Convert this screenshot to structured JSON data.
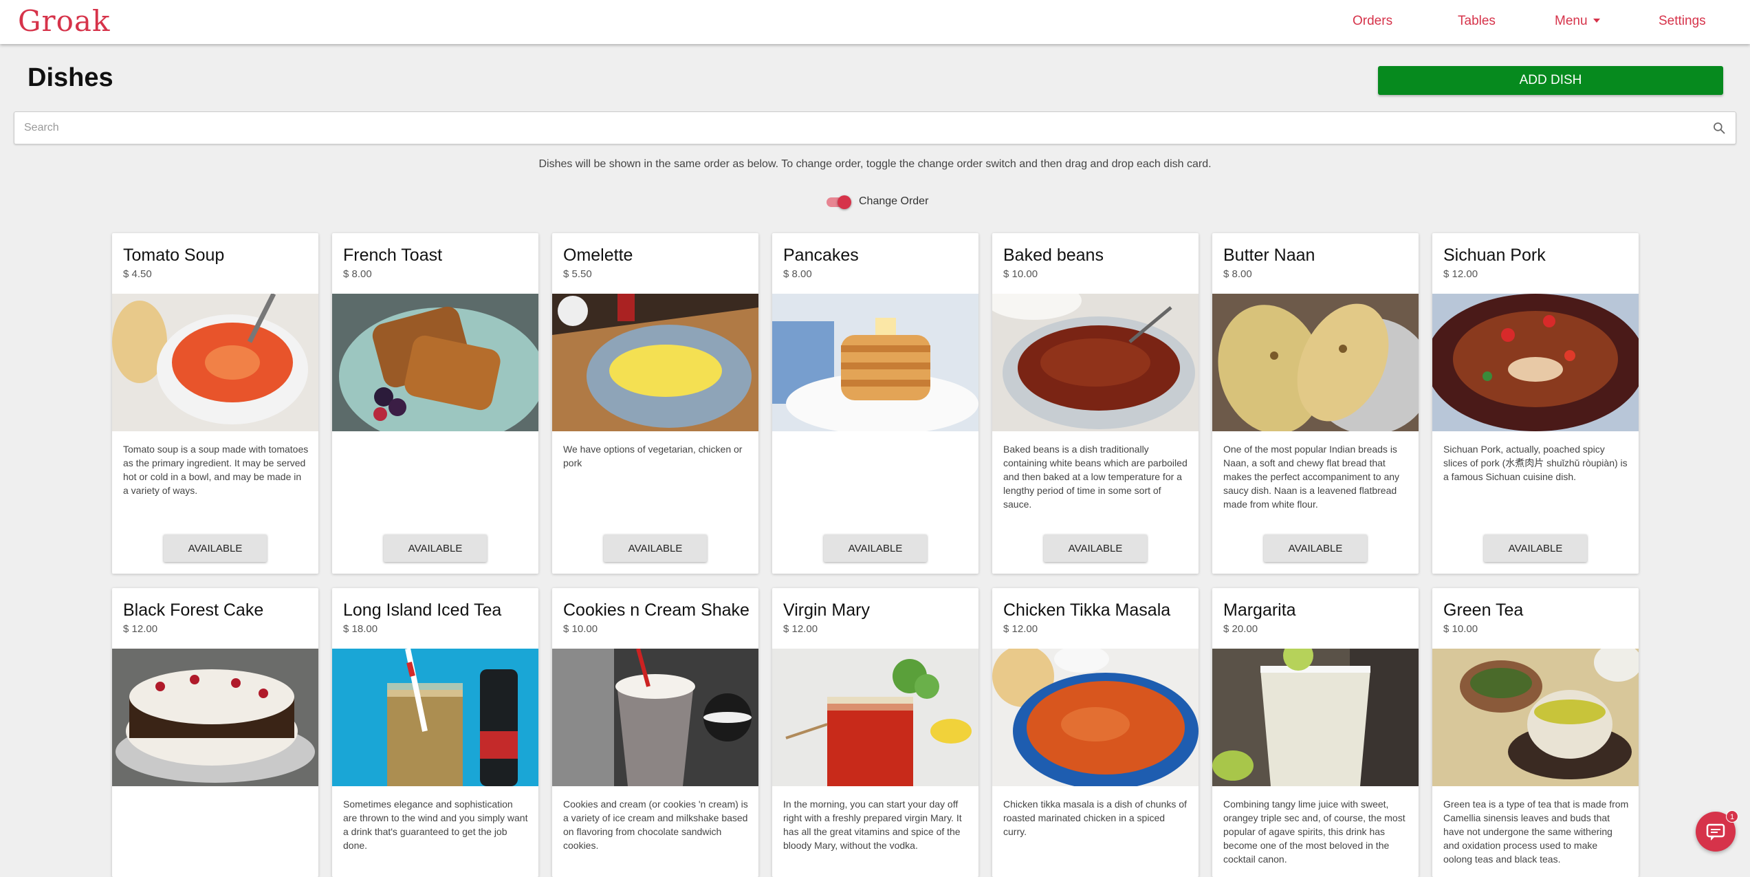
{
  "app": {
    "logo": "Groak"
  },
  "nav": {
    "orders": "Orders",
    "tables": "Tables",
    "menu": "Menu",
    "settings": "Settings"
  },
  "header": {
    "title": "Dishes",
    "add_button": "ADD DISH"
  },
  "search": {
    "placeholder": "Search",
    "value": ""
  },
  "helper_text": "Dishes will be shown in the same order as below. To change order, toggle the change order switch and then drag and drop each dish card.",
  "change_order": {
    "label": "Change Order",
    "on": true
  },
  "accent_color": "#d6334a",
  "add_button_color": "#068a1e",
  "dishes": [
    {
      "name": "Tomato Soup",
      "price": "$ 4.50",
      "description": "Tomato soup is a soup made with tomatoes as the primary ingredient. It may be served hot or cold in a bowl, and may be made in a variety of ways.",
      "status": "AVAILABLE",
      "image": "tomato-soup-image"
    },
    {
      "name": "French Toast",
      "price": "$ 8.00",
      "description": "",
      "status": "AVAILABLE",
      "image": "french-toast-image"
    },
    {
      "name": "Omelette",
      "price": "$ 5.50",
      "description": "We have options of vegetarian, chicken or pork",
      "status": "AVAILABLE",
      "image": "omelette-image"
    },
    {
      "name": "Pancakes",
      "price": "$ 8.00",
      "description": "",
      "status": "AVAILABLE",
      "image": "pancakes-image"
    },
    {
      "name": "Baked beans",
      "price": "$ 10.00",
      "description": "Baked beans is a dish traditionally containing white beans which are parboiled and then baked at a low temperature for a lengthy period of time in some sort of sauce.",
      "status": "AVAILABLE",
      "image": "baked-beans-image"
    },
    {
      "name": "Butter Naan",
      "price": "$ 8.00",
      "description": "One of the most popular Indian breads is Naan, a soft and chewy flat bread that makes the perfect accompaniment to any saucy dish. Naan is a leavened flatbread made from white flour.",
      "status": "AVAILABLE",
      "image": "butter-naan-image"
    },
    {
      "name": "Sichuan Pork",
      "price": "$ 12.00",
      "description": "Sichuan Pork, actually, poached spicy slices of pork (水煮肉片 shuǐzhǔ ròupiàn) is a famous Sichuan cuisine dish.",
      "status": "AVAILABLE",
      "image": "sichuan-pork-image"
    },
    {
      "name": "Black Forest Cake",
      "price": "$ 12.00",
      "description": "",
      "status": "",
      "image": "black-forest-cake-image"
    },
    {
      "name": "Long Island Iced Tea",
      "price": "$ 18.00",
      "description": "Sometimes elegance and sophistication are thrown to the wind and you simply want a drink that's guaranteed to get the job done.",
      "status": "",
      "image": "long-island-iced-tea-image"
    },
    {
      "name": "Cookies n Cream Shake",
      "price": "$ 10.00",
      "description": "Cookies and cream (or cookies 'n cream) is a variety of ice cream and milkshake based on flavoring from chocolate sandwich cookies.",
      "status": "",
      "image": "cookies-cream-shake-image"
    },
    {
      "name": "Virgin Mary",
      "price": "$ 12.00",
      "description": "In the morning, you can start your day off right with a freshly prepared virgin Mary. It has all the great vitamins and spice of the bloody Mary, without the vodka.",
      "status": "",
      "image": "virgin-mary-image"
    },
    {
      "name": "Chicken Tikka Masala",
      "price": "$ 12.00",
      "description": "Chicken tikka masala is a dish of chunks of roasted marinated chicken in a spiced curry.",
      "status": "",
      "image": "chicken-tikka-masala-image"
    },
    {
      "name": "Margarita",
      "price": "$ 20.00",
      "description": "Combining tangy lime juice with sweet, orangey triple sec and, of course, the most popular of agave spirits, this drink has become one of the most beloved in the cocktail canon.",
      "status": "",
      "image": "margarita-image"
    },
    {
      "name": "Green Tea",
      "price": "$ 10.00",
      "description": "Green tea is a type of tea that is made from Camellia sinensis leaves and buds that have not undergone the same withering and oxidation process used to make oolong teas and black teas.",
      "status": "",
      "image": "green-tea-image"
    }
  ],
  "chat": {
    "badge_count": "1"
  }
}
